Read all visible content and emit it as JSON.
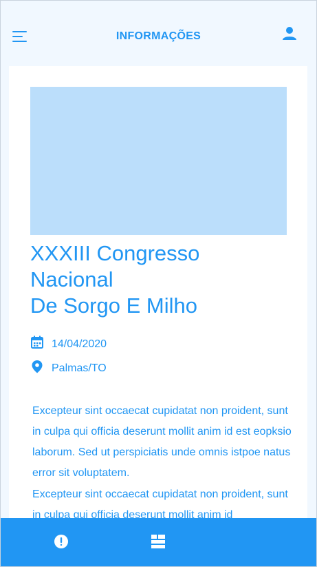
{
  "header": {
    "title": "INFORMAÇÕES",
    "menu_icon": "menu-icon",
    "user_icon": "account-icon"
  },
  "event": {
    "title_lines": [
      "XXXIII Congresso",
      "Nacional",
      "De Sorgo E Milho"
    ],
    "date": "14/04/2020",
    "location": "Palmas/TO",
    "date_icon": "calendar-icon",
    "location_icon": "location-pin-icon",
    "paragraphs": [
      "Excepteur sint occaecat cupidatat non proident, sunt in culpa qui officia deserunt mollit anim id est eopksio laborum. Sed ut perspiciatis unde omnis istpoe natus error sit voluptatem.",
      "Excepteur sint occaecat cupidatat non proident, sunt in culpa qui officia deserunt mollit anim id"
    ]
  },
  "bottom_nav": {
    "items": [
      {
        "icon": "info-alert-icon",
        "active": true
      },
      {
        "icon": "list-view-icon",
        "active": false
      }
    ]
  },
  "colors": {
    "accent": "#2196f3",
    "background": "#f1f8ff",
    "image_placeholder": "#bbdefb",
    "card": "#ffffff"
  }
}
